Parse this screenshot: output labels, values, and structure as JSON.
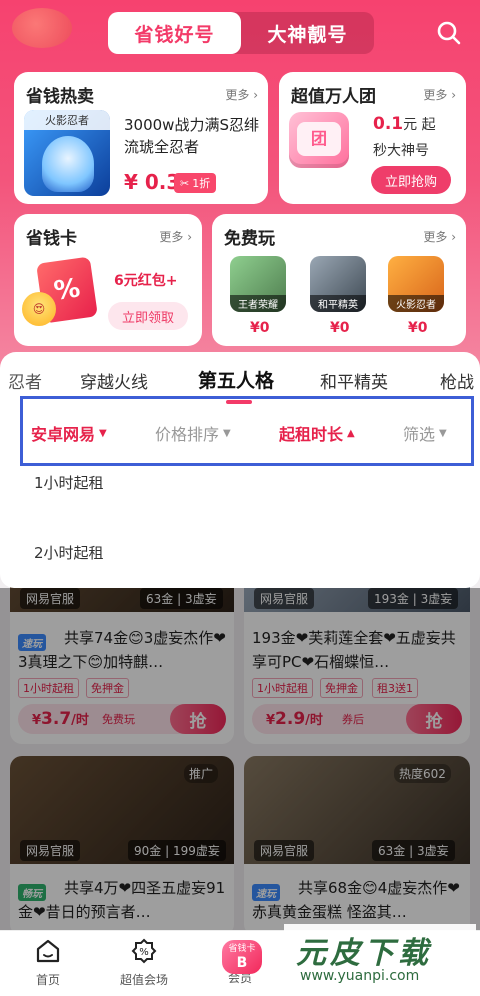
{
  "header": {
    "tabs": [
      "省钱好号",
      "大神靓号"
    ],
    "active_tab": 0
  },
  "cards": {
    "hot": {
      "title": "省钱热卖",
      "more": "更多",
      "game_label": "火影忍者",
      "item_title": "3000w战力满S忍绯流琥全忍者",
      "price": "¥ 0.3",
      "discount": "1折"
    },
    "group": {
      "title": "超值万人团",
      "more": "更多",
      "tv_text": "团",
      "price": "0.1元 起",
      "price_num": "0.1",
      "price_unit": "元 起",
      "subtitle": "秒大神号",
      "button": "立即抢购"
    },
    "card": {
      "title": "省钱卡",
      "more": "更多",
      "reward": "6元红包+",
      "button": "立即领取",
      "redpack_text": "%"
    },
    "free": {
      "title": "免费玩",
      "more": "更多",
      "games": [
        {
          "name": "王者荣耀",
          "price": "¥0"
        },
        {
          "name": "和平精英",
          "price": "¥0"
        },
        {
          "name": "火影忍者",
          "price": "¥0"
        }
      ]
    }
  },
  "game_tabs": [
    "忍者",
    "穿越火线",
    "第五人格",
    "和平精英",
    "枪战"
  ],
  "active_game_tab": 2,
  "filters": [
    {
      "label": "安卓网易",
      "state": "active-down"
    },
    {
      "label": "价格排序",
      "state": "inactive"
    },
    {
      "label": "起租时长",
      "state": "active-up"
    },
    {
      "label": "筛选",
      "state": "inactive"
    }
  ],
  "rent_options": [
    "1小时起租",
    "2小时起租"
  ],
  "listings": [
    {
      "official": "网易官服",
      "coin": "63金",
      "bonus": "3虚妄",
      "speed": "速玩",
      "title": "共享74金😊3虚妄杰作❤3真理之下😊加特麒…",
      "chips": [
        "1小时起租",
        "免押金"
      ],
      "price": "¥3.7/时",
      "price_num": "3.7",
      "price_unit": "/时",
      "promo": "免费玩",
      "grab": "抢"
    },
    {
      "official": "网易官服",
      "coin": "193金",
      "bonus": "3虚妄",
      "speed": "",
      "title": "193金❤芙莉莲全套❤五虚妄共享可PC❤石榴蝶恒…",
      "chips": [
        "1小时起租",
        "免押金",
        "租3送1"
      ],
      "price": "¥2.9/时",
      "price_num": "2.9",
      "price_unit": "/时",
      "promo": "券后",
      "grab": "抢"
    },
    {
      "official": "网易官服",
      "coin": "90金",
      "bonus": "199虚妄",
      "ad": "推广",
      "speed": "畅玩",
      "title": "共享4万❤四圣五虚妄91金❤昔日的预言者…"
    },
    {
      "official": "网易官服",
      "coin": "63金",
      "bonus": "3虚妄",
      "ad": "热度602",
      "speed": "速玩",
      "title": "共享68金😊4虚妄杰作❤赤真黄金蛋糕 怪盗其…"
    }
  ],
  "bottom_nav": [
    {
      "label": "首页"
    },
    {
      "label": "超值会场"
    },
    {
      "label": "会员",
      "badge": "省钱卡"
    }
  ],
  "watermark": {
    "text": "元皮下载",
    "url": "www.yuanpi.com"
  },
  "colors": {
    "brand": "#f33a68",
    "price": "#e6224b",
    "highlight_box": "#3d5ed6"
  }
}
